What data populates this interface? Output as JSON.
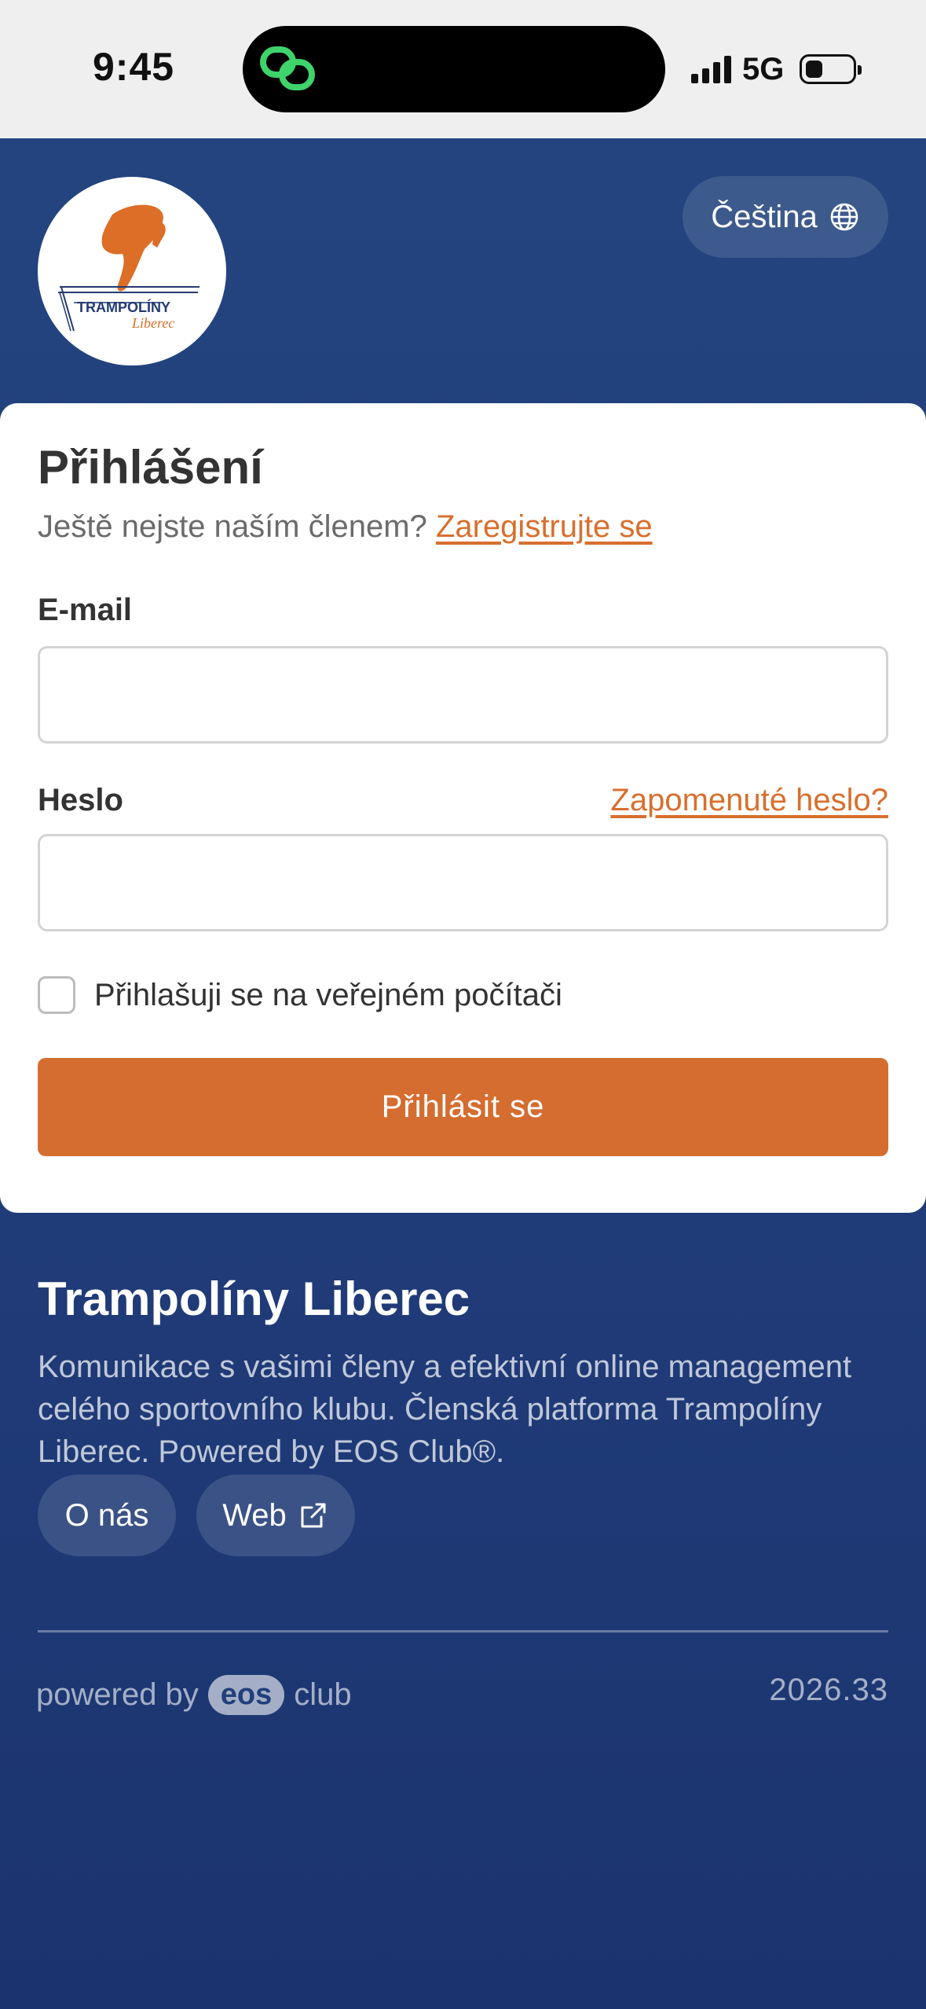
{
  "status_bar": {
    "time": "9:45",
    "network": "5G",
    "battery_level": 0.35
  },
  "header": {
    "logo_text_top": "TRAMPOLÍNY",
    "logo_text_bottom": "Liberec",
    "language_label": "Čeština",
    "language_icon": "globe-icon"
  },
  "login": {
    "title": "Přihlášení",
    "subtitle_text": "Ještě nejste naším členem?",
    "register_link": "Zaregistrujte se",
    "email_label": "E-mail",
    "email_value": "",
    "password_label": "Heslo",
    "password_value": "",
    "forgot_link": "Zapomenuté heslo?",
    "public_pc_label": "Přihlašuji se na veřejném počítači",
    "public_pc_checked": false,
    "submit_label": "Přihlásit se"
  },
  "footer": {
    "club_name": "Trampolíny Liberec",
    "description": "Komunikace s vašimi členy a efektivní online management celého sportovního klubu. Členská platforma Trampolíny Liberec. Powered by EOS Club®.",
    "about_label": "O nás",
    "web_label": "Web",
    "web_icon": "external-link-icon",
    "powered_by": "powered by",
    "eos_badge": "eos",
    "club_word": "club",
    "version": "2026.33"
  },
  "colors": {
    "brand_blue": "#23457f",
    "accent_orange": "#d46d2f"
  }
}
